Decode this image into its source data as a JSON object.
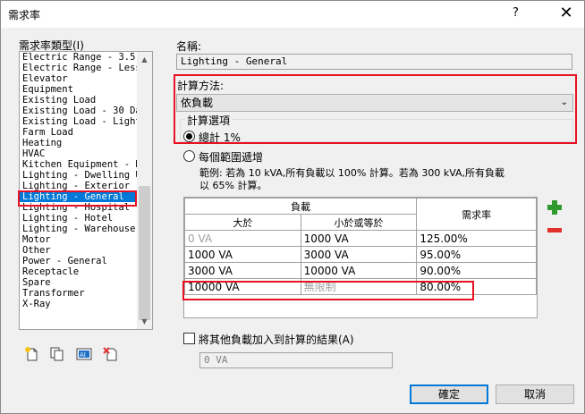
{
  "window": {
    "title": "需求率",
    "help_glyph": "?",
    "close_glyph": "✕"
  },
  "left": {
    "types_label": "需求率類型(I)",
    "items": [
      "Electric Range - 3.5 ...",
      "Electric Range - Less",
      "Elevator",
      "Equipment",
      "Existing Load",
      "Existing Load - 30 Day",
      "Existing Load - Light",
      "Farm Load",
      "Heating",
      "HVAC",
      "Kitchen Equipment - No",
      "Lighting - Dwelling U",
      "Lighting - Exterior",
      "Lighting - General",
      "Lighting - Hospital",
      "Lighting - Hotel",
      "Lighting - Warehouse",
      "Motor",
      "Other",
      "Power - General",
      "Receptacle",
      "Spare",
      "Transformer",
      "X-Ray"
    ],
    "selected_index": 13
  },
  "right": {
    "name_label": "名稱:",
    "name_value": "Lighting - General",
    "calc_method_label": "計算方法:",
    "calc_method_value": "依負載",
    "calc_options_label": "計算選項",
    "option_total_label": "總計 1%",
    "option_incremental_label": "每個範圍遞增",
    "example_text_line1": "範例: 若為 10 kVA,所有負載以 100% 計算。若為 300 kVA,所有負載",
    "example_text_line2": "以 65% 計算。",
    "table": {
      "header_load": "負載",
      "header_greater": "大於",
      "header_less_equal": "小於或等於",
      "header_factor": "需求率",
      "rows": [
        {
          "greater": "0 VA",
          "less_equal": "1000 VA",
          "factor": "125.00%"
        },
        {
          "greater": "1000 VA",
          "less_equal": "3000 VA",
          "factor": "95.00%"
        },
        {
          "greater": "3000 VA",
          "less_equal": "10000 VA",
          "factor": "90.00%"
        },
        {
          "greater": "10000 VA",
          "less_equal": "無限制",
          "factor": "80.00%"
        }
      ]
    },
    "add_load_label": "將其他負載加入到計算的結果(A)",
    "add_load_value": "0 VA"
  },
  "buttons": {
    "ok": "確定",
    "cancel": "取消"
  },
  "colors": {
    "accent": "#0078d7",
    "highlight_red": "#e81123",
    "add_green": "#2e9a2e",
    "remove_red": "#e0302a"
  }
}
